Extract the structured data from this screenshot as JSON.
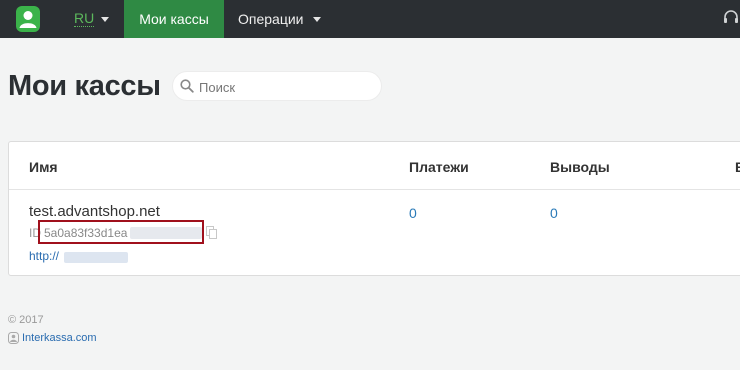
{
  "nav": {
    "lang": "RU",
    "active_tab": "Мои кассы",
    "operations": "Операции"
  },
  "page": {
    "title": "Мои кассы",
    "search_placeholder": "Поиск"
  },
  "table": {
    "columns": [
      "Имя",
      "Платежи",
      "Выводы",
      "В"
    ],
    "rows": [
      {
        "name": "test.advantshop.net",
        "id_label": "ID",
        "id_value": "5a0a83f33d1ea",
        "url": "http://",
        "payments": "0",
        "withdrawals": "0"
      }
    ]
  },
  "footer": {
    "copyright": "© 2017",
    "link": "Interkassa.com"
  },
  "colors": {
    "topbar": "#2b2f33",
    "active_tab": "#2f8a44",
    "highlight_box": "#a0101c",
    "link": "#2a6cb0"
  }
}
